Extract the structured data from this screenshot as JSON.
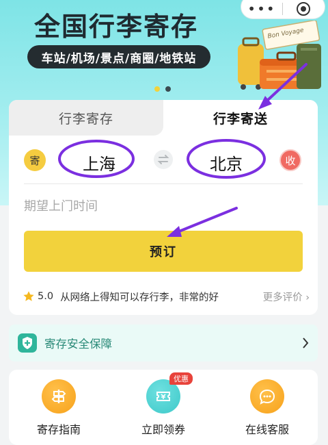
{
  "banner": {
    "title": "全国行李寄存",
    "subtitle": "车站/机场/景点/商圈/地铁站",
    "luggage_tag_text": "Bon Voyage",
    "carousel": {
      "count": 2,
      "active_index": 0,
      "active_color": "#f2d23c",
      "inactive_color": "#3b4a50"
    }
  },
  "capsule": {
    "more_glyph": "•••",
    "close_icon": "target-icon"
  },
  "tabs": [
    {
      "label": "行李寄存",
      "active": false
    },
    {
      "label": "行李寄送",
      "active": true
    }
  ],
  "route": {
    "from_badge": "寄",
    "from_city": "上海",
    "to_city": "北京",
    "to_badge": "收",
    "swap_icon": "swap-arrows-icon"
  },
  "pickup_time": {
    "placeholder": "期望上门时间",
    "value": ""
  },
  "book_button": {
    "label": "预订"
  },
  "review": {
    "rating": "5.0",
    "text": "从网络上得知可以存行李，非常的好",
    "more_label": "更多评价"
  },
  "safety": {
    "label": "寄存安全保障",
    "icon": "shield-plus-icon"
  },
  "quick_actions": [
    {
      "label": "寄存指南",
      "icon": "signpost-icon",
      "color": "#f7a21b"
    },
    {
      "label": "立即领券",
      "icon": "ticket-icon",
      "color": "#3ec9c9",
      "badge": "优惠"
    },
    {
      "label": "在线客服",
      "icon": "chat-icon",
      "color": "#f7a21b"
    }
  ],
  "colors": {
    "accent_yellow": "#f2d23c",
    "annotation_purple": "#7b2fe0",
    "teal": "#2a8a78",
    "badge_red": "#e8433b"
  }
}
